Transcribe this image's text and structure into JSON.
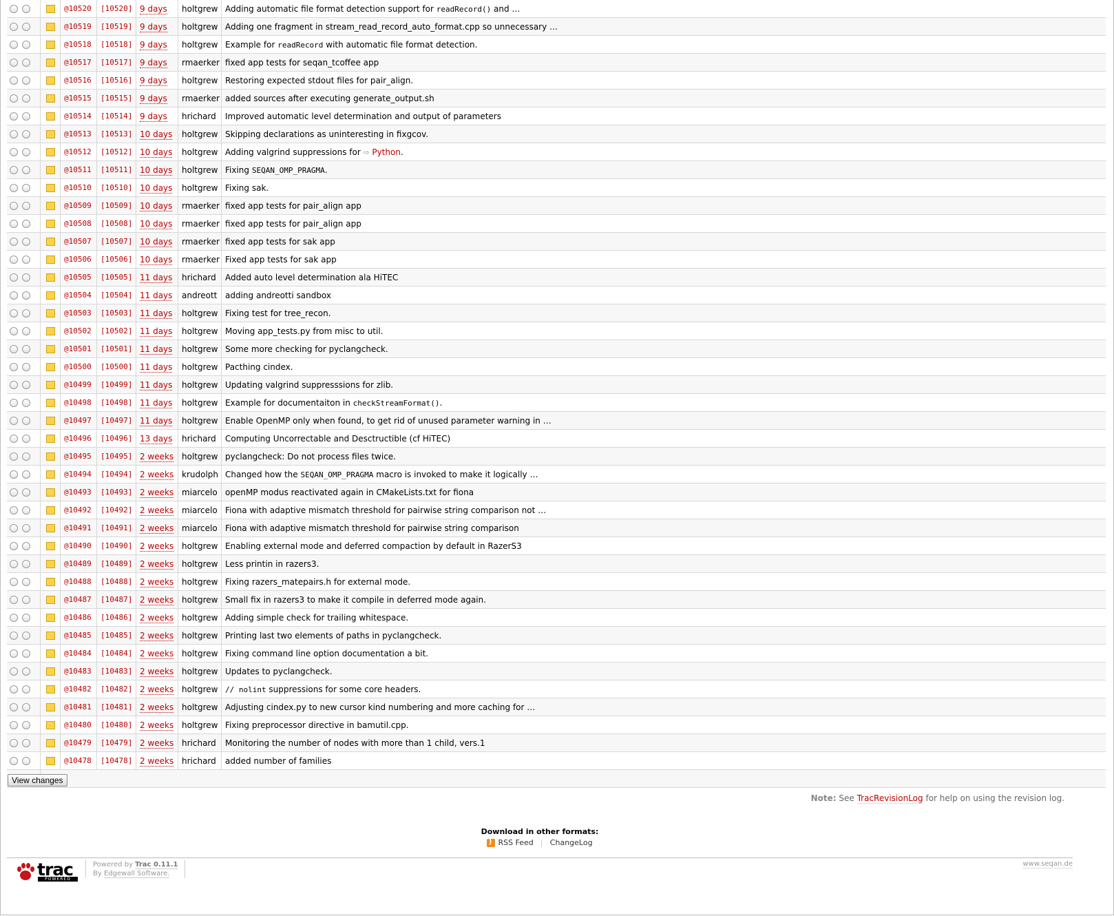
{
  "changes": [
    {
      "path_rev": "@10520",
      "rev": "[10520]",
      "age": "9 days",
      "author": "holtgrew",
      "summary": [
        {
          "t": "Adding automatic file format detection support for "
        },
        {
          "c": "readRecord()"
        },
        {
          "t": " and …"
        }
      ]
    },
    {
      "path_rev": "@10519",
      "rev": "[10519]",
      "age": "9 days",
      "author": "holtgrew",
      "summary": [
        {
          "t": "Adding one fragment in stream_read_record_auto_format.cpp so unnecessary …"
        }
      ]
    },
    {
      "path_rev": "@10518",
      "rev": "[10518]",
      "age": "9 days",
      "author": "holtgrew",
      "summary": [
        {
          "t": "Example for "
        },
        {
          "c": "readRecord"
        },
        {
          "t": " with automatic file format detection."
        }
      ]
    },
    {
      "path_rev": "@10517",
      "rev": "[10517]",
      "age": "9 days",
      "author": "rmaerker",
      "summary": [
        {
          "t": "fixed app tests for seqan_tcoffee app"
        }
      ]
    },
    {
      "path_rev": "@10516",
      "rev": "[10516]",
      "age": "9 days",
      "author": "holtgrew",
      "summary": [
        {
          "t": "Restoring expected stdout files for pair_align."
        }
      ]
    },
    {
      "path_rev": "@10515",
      "rev": "[10515]",
      "age": "9 days",
      "author": "rmaerker",
      "summary": [
        {
          "t": "added sources after executing generate_output.sh"
        }
      ]
    },
    {
      "path_rev": "@10514",
      "rev": "[10514]",
      "age": "9 days",
      "author": "hrichard",
      "summary": [
        {
          "t": "Improved automatic level determination and output of parameters"
        }
      ]
    },
    {
      "path_rev": "@10513",
      "rev": "[10513]",
      "age": "10 days",
      "author": "holtgrew",
      "summary": [
        {
          "t": "Skipping declarations as uninteresting in fixgcov."
        }
      ]
    },
    {
      "path_rev": "@10512",
      "rev": "[10512]",
      "age": "10 days",
      "author": "holtgrew",
      "summary": [
        {
          "t": "Adding valgrind suppressions for "
        },
        {
          "x": "Python"
        },
        {
          "t": "."
        }
      ]
    },
    {
      "path_rev": "@10511",
      "rev": "[10511]",
      "age": "10 days",
      "author": "holtgrew",
      "summary": [
        {
          "t": "Fixing "
        },
        {
          "c": "SEQAN_OMP_PRAGMA"
        },
        {
          "t": "."
        }
      ]
    },
    {
      "path_rev": "@10510",
      "rev": "[10510]",
      "age": "10 days",
      "author": "holtgrew",
      "summary": [
        {
          "t": "Fixing sak."
        }
      ]
    },
    {
      "path_rev": "@10509",
      "rev": "[10509]",
      "age": "10 days",
      "author": "rmaerker",
      "summary": [
        {
          "t": "fixed app tests for pair_align app"
        }
      ]
    },
    {
      "path_rev": "@10508",
      "rev": "[10508]",
      "age": "10 days",
      "author": "rmaerker",
      "summary": [
        {
          "t": "fixed app tests for pair_align app"
        }
      ]
    },
    {
      "path_rev": "@10507",
      "rev": "[10507]",
      "age": "10 days",
      "author": "rmaerker",
      "summary": [
        {
          "t": "fixed app tests for sak app"
        }
      ]
    },
    {
      "path_rev": "@10506",
      "rev": "[10506]",
      "age": "10 days",
      "author": "rmaerker",
      "summary": [
        {
          "t": "Fixed app tests for sak app"
        }
      ]
    },
    {
      "path_rev": "@10505",
      "rev": "[10505]",
      "age": "11 days",
      "author": "hrichard",
      "summary": [
        {
          "t": "Added auto level determination ala HiTEC"
        }
      ]
    },
    {
      "path_rev": "@10504",
      "rev": "[10504]",
      "age": "11 days",
      "author": "andreott",
      "summary": [
        {
          "t": "adding andreotti sandbox"
        }
      ]
    },
    {
      "path_rev": "@10503",
      "rev": "[10503]",
      "age": "11 days",
      "author": "holtgrew",
      "summary": [
        {
          "t": "Fixing test for tree_recon."
        }
      ]
    },
    {
      "path_rev": "@10502",
      "rev": "[10502]",
      "age": "11 days",
      "author": "holtgrew",
      "summary": [
        {
          "t": "Moving app_tests.py from misc to util."
        }
      ]
    },
    {
      "path_rev": "@10501",
      "rev": "[10501]",
      "age": "11 days",
      "author": "holtgrew",
      "summary": [
        {
          "t": "Some more checking for pyclangcheck."
        }
      ]
    },
    {
      "path_rev": "@10500",
      "rev": "[10500]",
      "age": "11 days",
      "author": "holtgrew",
      "summary": [
        {
          "t": "Pacthing cindex."
        }
      ]
    },
    {
      "path_rev": "@10499",
      "rev": "[10499]",
      "age": "11 days",
      "author": "holtgrew",
      "summary": [
        {
          "t": "Updating valgrind suppresssions for zlib."
        }
      ]
    },
    {
      "path_rev": "@10498",
      "rev": "[10498]",
      "age": "11 days",
      "author": "holtgrew",
      "summary": [
        {
          "t": "Example for documentaiton in "
        },
        {
          "c": "checkStreamFormat()"
        },
        {
          "t": "."
        }
      ]
    },
    {
      "path_rev": "@10497",
      "rev": "[10497]",
      "age": "11 days",
      "author": "holtgrew",
      "summary": [
        {
          "t": "Enable OpenMP only when found, to get rid of unused parameter warning in …"
        }
      ]
    },
    {
      "path_rev": "@10496",
      "rev": "[10496]",
      "age": "13 days",
      "author": "hrichard",
      "summary": [
        {
          "t": "Computing Uncorrectable and Desctructible (cf HiTEC)"
        }
      ]
    },
    {
      "path_rev": "@10495",
      "rev": "[10495]",
      "age": "2 weeks",
      "author": "holtgrew",
      "summary": [
        {
          "t": "pyclangcheck: Do not process files twice."
        }
      ]
    },
    {
      "path_rev": "@10494",
      "rev": "[10494]",
      "age": "2 weeks",
      "author": "krudolph",
      "summary": [
        {
          "t": "Changed how the "
        },
        {
          "c": "SEQAN_OMP_PRAGMA"
        },
        {
          "t": " macro is invoked to make it logically …"
        }
      ]
    },
    {
      "path_rev": "@10493",
      "rev": "[10493]",
      "age": "2 weeks",
      "author": "miarcelo",
      "summary": [
        {
          "t": "openMP modus reactivated again in CMakeLists.txt for fiona"
        }
      ]
    },
    {
      "path_rev": "@10492",
      "rev": "[10492]",
      "age": "2 weeks",
      "author": "miarcelo",
      "summary": [
        {
          "t": "Fiona with adaptive mismatch threshold for pairwise string comparison not …"
        }
      ]
    },
    {
      "path_rev": "@10491",
      "rev": "[10491]",
      "age": "2 weeks",
      "author": "miarcelo",
      "summary": [
        {
          "t": "Fiona with adaptive mismatch threshold for pairwise string comparison"
        }
      ]
    },
    {
      "path_rev": "@10490",
      "rev": "[10490]",
      "age": "2 weeks",
      "author": "holtgrew",
      "summary": [
        {
          "t": "Enabling external mode and deferred compaction by default in RazerS3"
        }
      ]
    },
    {
      "path_rev": "@10489",
      "rev": "[10489]",
      "age": "2 weeks",
      "author": "holtgrew",
      "summary": [
        {
          "t": "Less printin in razers3."
        }
      ]
    },
    {
      "path_rev": "@10488",
      "rev": "[10488]",
      "age": "2 weeks",
      "author": "holtgrew",
      "summary": [
        {
          "t": "Fixing razers_matepairs.h for external mode."
        }
      ]
    },
    {
      "path_rev": "@10487",
      "rev": "[10487]",
      "age": "2 weeks",
      "author": "holtgrew",
      "summary": [
        {
          "t": "Small fix in razers3 to make it compile in deferred mode again."
        }
      ]
    },
    {
      "path_rev": "@10486",
      "rev": "[10486]",
      "age": "2 weeks",
      "author": "holtgrew",
      "summary": [
        {
          "t": "Adding simple check for trailing whitespace."
        }
      ]
    },
    {
      "path_rev": "@10485",
      "rev": "[10485]",
      "age": "2 weeks",
      "author": "holtgrew",
      "summary": [
        {
          "t": "Printing last two elements of paths in pyclangcheck."
        }
      ]
    },
    {
      "path_rev": "@10484",
      "rev": "[10484]",
      "age": "2 weeks",
      "author": "holtgrew",
      "summary": [
        {
          "t": "Fixing command line option documentation a bit."
        }
      ]
    },
    {
      "path_rev": "@10483",
      "rev": "[10483]",
      "age": "2 weeks",
      "author": "holtgrew",
      "summary": [
        {
          "t": "Updates to pyclangcheck."
        }
      ]
    },
    {
      "path_rev": "@10482",
      "rev": "[10482]",
      "age": "2 weeks",
      "author": "holtgrew",
      "summary": [
        {
          "c": "// nolint"
        },
        {
          "t": " suppressions for some core headers."
        }
      ]
    },
    {
      "path_rev": "@10481",
      "rev": "[10481]",
      "age": "2 weeks",
      "author": "holtgrew",
      "summary": [
        {
          "t": "Adjusting cindex.py to new cursor kind numbering and more caching for …"
        }
      ]
    },
    {
      "path_rev": "@10480",
      "rev": "[10480]",
      "age": "2 weeks",
      "author": "holtgrew",
      "summary": [
        {
          "t": "Fixing preprocessor directive in bamutil.cpp."
        }
      ]
    },
    {
      "path_rev": "@10479",
      "rev": "[10479]",
      "age": "2 weeks",
      "author": "hrichard",
      "summary": [
        {
          "t": "Monitoring the number of nodes with more than 1 child, vers.1"
        }
      ]
    },
    {
      "path_rev": "@10478",
      "rev": "[10478]",
      "age": "2 weeks",
      "author": "hrichard",
      "summary": [
        {
          "t": "added number of families"
        }
      ]
    }
  ],
  "view_changes_label": "View changes",
  "note": {
    "label": "Note:",
    "pre": "See",
    "link": "TracRevisionLog",
    "post": "for help on using the revision log."
  },
  "alt_links": {
    "heading": "Download in other formats:",
    "rss": "RSS Feed",
    "changelog": "ChangeLog"
  },
  "footer": {
    "logo_word": "trac",
    "logo_badge": "POWERED",
    "powered_by": "Powered by",
    "trac_version": "Trac 0.11.1",
    "by": "By",
    "edgewall": "Edgewall Software.",
    "site": "www.seqan.de"
  },
  "colors": {
    "link": "#bb0000",
    "edit_icon": "#ffd24a",
    "rss": "#f18c1d"
  }
}
